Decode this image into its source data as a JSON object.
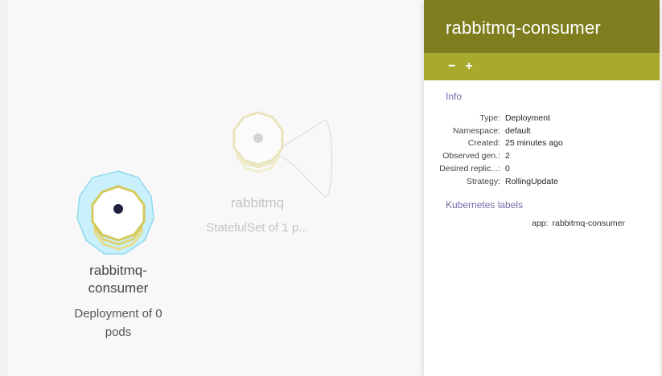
{
  "graph": {
    "nodes": [
      {
        "name": "rabbitmq-",
        "name2": "consumer",
        "subtitle1": "Deployment of 0",
        "subtitle2": "pods",
        "selected": true
      },
      {
        "name": "rabbitmq",
        "subtitle1": "StatefulSet of 1 p...",
        "selected": false
      }
    ]
  },
  "panel": {
    "title": "rabbitmq-consumer",
    "toolbar": {
      "collapse": "−",
      "expand": "+"
    },
    "info_title": "Info",
    "info": [
      {
        "key": "Type:",
        "value": "Deployment"
      },
      {
        "key": "Namespace:",
        "value": "default"
      },
      {
        "key": "Created:",
        "value": "25 minutes ago"
      },
      {
        "key": "Observed gen.:",
        "value": "2"
      },
      {
        "key": "Desired replic...:",
        "value": "0"
      },
      {
        "key": "Strategy:",
        "value": "RollingUpdate"
      }
    ],
    "labels_title": "Kubernetes labels",
    "labels": [
      {
        "key": "app:",
        "value": "rabbitmq-consumer"
      }
    ]
  },
  "colors": {
    "header": "#7e7e1e",
    "toolbar": "#a7aa2a",
    "accent_text": "#6d6ba8",
    "node_yellow": "#d9d06a",
    "node_selected_halo": "#a9e6f4"
  }
}
